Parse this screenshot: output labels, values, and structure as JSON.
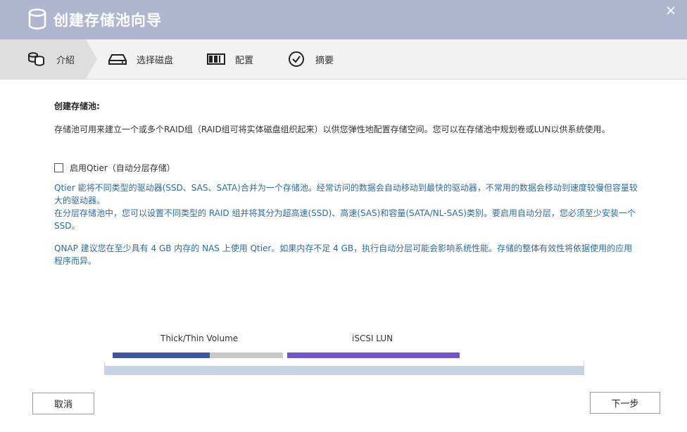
{
  "window": {
    "title": "创建存储池向导",
    "title_icon": "database-icon",
    "close_icon": "close-icon"
  },
  "steps": [
    {
      "label": "介紹",
      "icon": "storage-pool-icon",
      "active": true
    },
    {
      "label": "选择磁盘",
      "icon": "disk-drive-icon",
      "active": false
    },
    {
      "label": "配置",
      "icon": "raid-config-icon",
      "active": false
    },
    {
      "label": "摘要",
      "icon": "check-circle-icon",
      "active": false
    }
  ],
  "main": {
    "heading": "创建存储池:",
    "description": "存储池可用来建立一个或多个RAID组（RAID组可将实体磁盘组织起来）以供您弹性地配置存储空间。您可以在存储池中规划卷或LUN以供系统使用。",
    "qtier_checkbox": {
      "label": "启用Qtier（自动分层存储）",
      "checked": false
    },
    "qtier_info_1": "Qtier 能将不同类型的驱动器(SSD、SAS、SATA)合并为一个存储池。经常访问的数据会自动移动到最快的驱动器，不常用的数据会移动到速度较慢但容量较大的驱动器。",
    "qtier_info_2": "在分层存储池中，您可以设置不同类型的 RAID 组并将其分为超高速(SSD)、高速(SAS)和容量(SATA/NL-SAS)类别。要启用自动分层，您必须至少安装一个 SSD。",
    "qtier_info_3": "QNAP 建议您在至少具有 4 GB 内存的 NAS 上使用 Qtier。如果内存不足 4 GB，执行自动分层可能会影响系统性能。存储的整体有效性将依据使用的应用程序而异。"
  },
  "diagram": {
    "volume_label": "Thick/Thin Volume",
    "lun_label": "iSCSI LUN",
    "colors": {
      "volume": "#3f56a6",
      "volume_free": "#c8c8c8",
      "lun": "#6f55c8",
      "pool": "#c7d3e0"
    }
  },
  "footer": {
    "cancel_label": "取消",
    "next_label": "下一步"
  }
}
